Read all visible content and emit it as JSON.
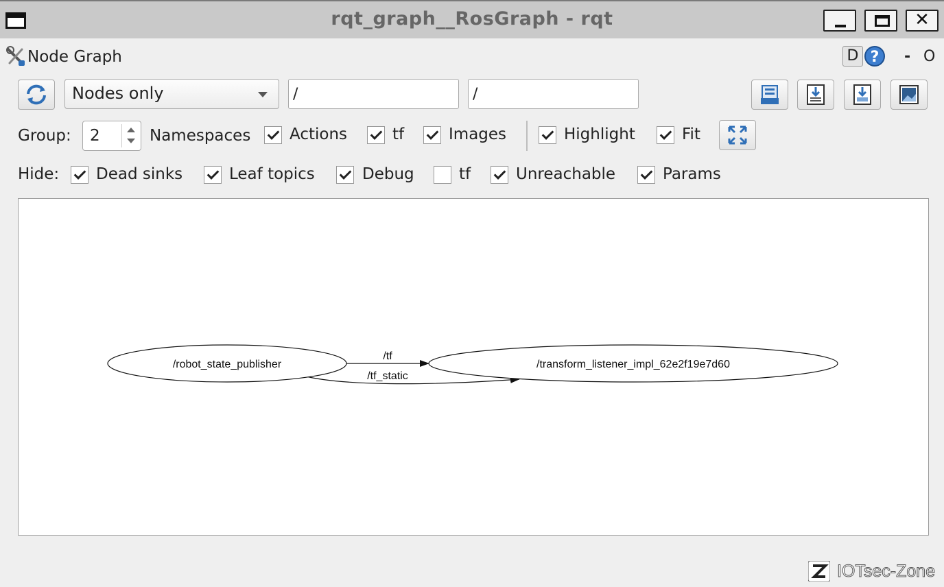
{
  "window": {
    "title": "rqt_graph__RosGraph - rqt"
  },
  "plugin": {
    "title": "Node Graph",
    "d_label": "D",
    "dash_label": "-",
    "o_label": "O"
  },
  "toolbar": {
    "mode": "Nodes only",
    "namespace_filter": "/",
    "topic_filter": "/"
  },
  "options": {
    "group_label": "Group:",
    "group_value": "2",
    "namespaces_label": "Namespaces",
    "actions": {
      "label": "Actions",
      "checked": true
    },
    "tf": {
      "label": "tf",
      "checked": true
    },
    "images": {
      "label": "Images",
      "checked": true
    },
    "highlight": {
      "label": "Highlight",
      "checked": true
    },
    "fit": {
      "label": "Fit",
      "checked": true
    }
  },
  "hide": {
    "label": "Hide:",
    "dead_sinks": {
      "label": "Dead sinks",
      "checked": true
    },
    "leaf_topics": {
      "label": "Leaf topics",
      "checked": true
    },
    "debug": {
      "label": "Debug",
      "checked": true
    },
    "tf": {
      "label": "tf",
      "checked": false
    },
    "unreachable": {
      "label": "Unreachable",
      "checked": true
    },
    "params": {
      "label": "Params",
      "checked": true
    }
  },
  "graph": {
    "nodes": [
      {
        "id": "rsp",
        "label": "/robot_state_publisher"
      },
      {
        "id": "tli",
        "label": "/transform_listener_impl_62e2f19e7d60"
      }
    ],
    "edges": [
      {
        "from": "rsp",
        "to": "tli",
        "label": "/tf"
      },
      {
        "from": "rsp",
        "to": "tli",
        "label": "/tf_static"
      }
    ]
  },
  "watermark": {
    "text": "IOTsec-Zone"
  },
  "colors": {
    "titlebar": "#c9c9c9",
    "background": "#efefef",
    "canvas": "#ffffff",
    "icon_blue": "#2f6fb7"
  }
}
